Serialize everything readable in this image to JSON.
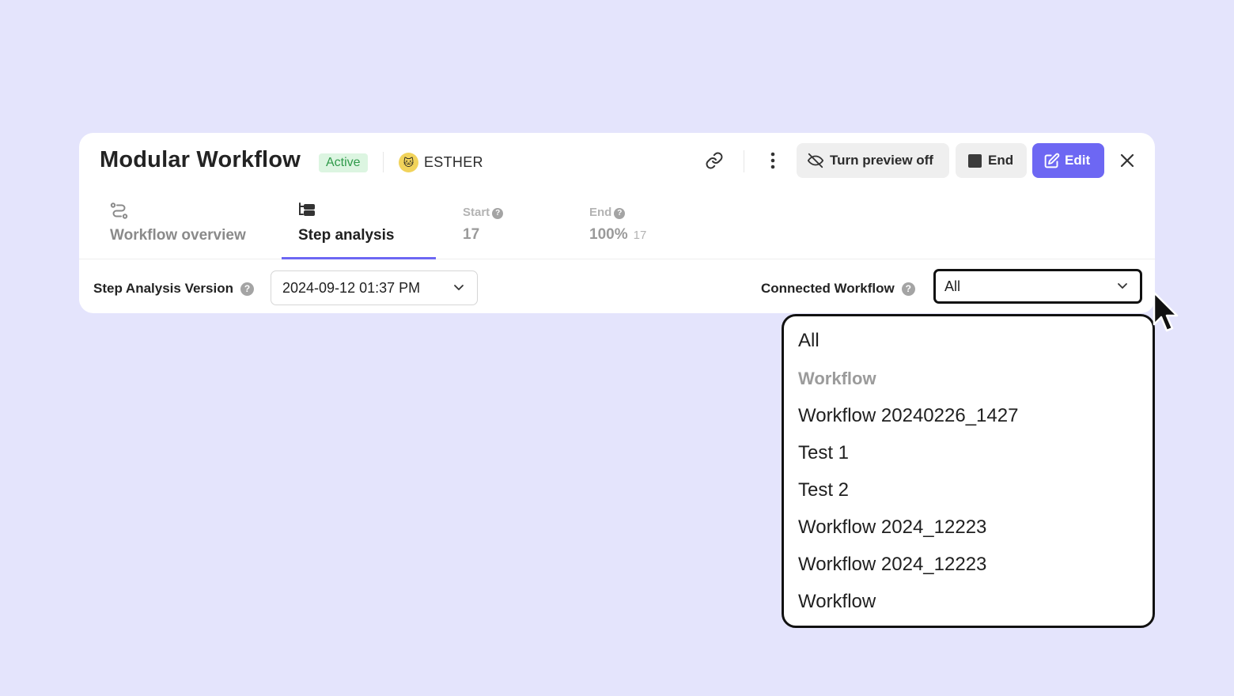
{
  "header": {
    "title": "Modular Workflow",
    "status": "Active",
    "owner": "ESTHER",
    "owner_avatar": "🐱",
    "preview_label": "Turn preview off",
    "end_label": "End",
    "edit_label": "Edit"
  },
  "tabs": [
    {
      "label": "Workflow overview",
      "icon": "workflow-icon",
      "active": false
    },
    {
      "label": "Step analysis",
      "icon": "step-analysis-icon",
      "active": true
    }
  ],
  "stats": {
    "start": {
      "label": "Start",
      "value": "17"
    },
    "end": {
      "label": "End",
      "value": "100%",
      "sub": "17"
    }
  },
  "filters": {
    "version_label": "Step Analysis Version",
    "version_value": "2024-09-12 01:37 PM",
    "connected_label": "Connected Workflow",
    "connected_value": "All"
  },
  "dropdown": {
    "options": [
      {
        "label": "All",
        "group": false
      },
      {
        "label": "Workflow",
        "group": true
      },
      {
        "label": "Workflow 20240226_1427",
        "group": false
      },
      {
        "label": "Test 1",
        "group": false
      },
      {
        "label": "Test 2",
        "group": false
      },
      {
        "label": "Workflow 2024_12223",
        "group": false
      },
      {
        "label": "Workflow 2024_12223",
        "group": false
      },
      {
        "label": "Workflow",
        "group": false
      }
    ]
  },
  "colors": {
    "background": "#e4e4fc",
    "accent": "#6d67f3",
    "active_badge_bg": "#dcf5e1",
    "active_badge_text": "#2f9a4a"
  }
}
